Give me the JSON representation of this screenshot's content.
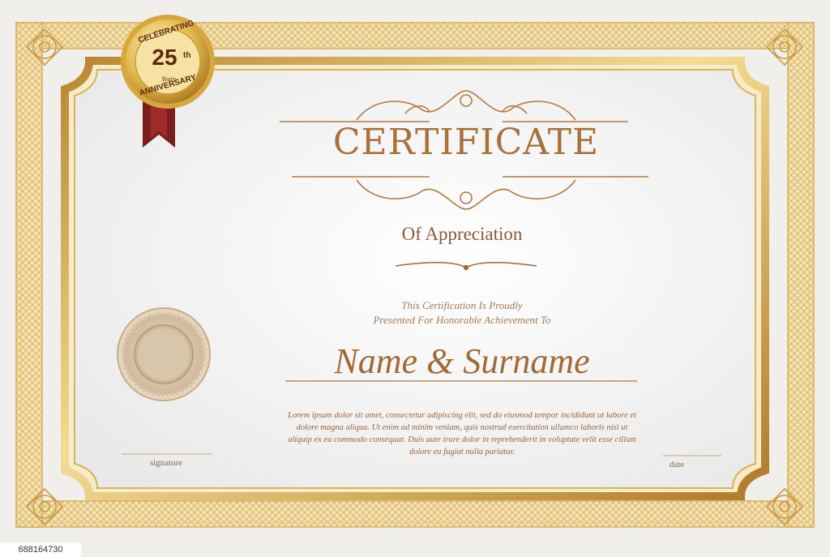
{
  "certificate": {
    "title": "CERTIFICATE",
    "subtitle": "Of Appreciation",
    "presented_line1": "This Certification Is Proudly",
    "presented_line2": "Presented For Honorable Achievement To",
    "name": "Name & Surname",
    "body_text": "Lorem ipsum dolor sit amet, consectetur adipiscing elit, sed do eiusmod tempor incididunt ut labore et dolore magna aliqua. Ut enim ad minim veniam, quis nostrud exercitation ullamco laboris nisi ut aliquip ex ea commodo consequat. Duis aute irure dolor in reprehenderit in voluptate velit esse cillum dolore eu fugiat nulla pariatur.",
    "signature_label": "signature",
    "date_label": "date"
  },
  "badge": {
    "top_text": "CELEBRATING",
    "number": "25",
    "suffix": "th",
    "years": "Years",
    "bottom_text": "ANNIVERSARY"
  },
  "stock_id": "688164730",
  "colors": {
    "gold": "#d9b45a",
    "gold_light": "#ecd494",
    "bronze_text": "#a8703a",
    "ribbon": "#7a1d1d",
    "paper": "#ffffff",
    "outer_bg": "#f0efec"
  }
}
